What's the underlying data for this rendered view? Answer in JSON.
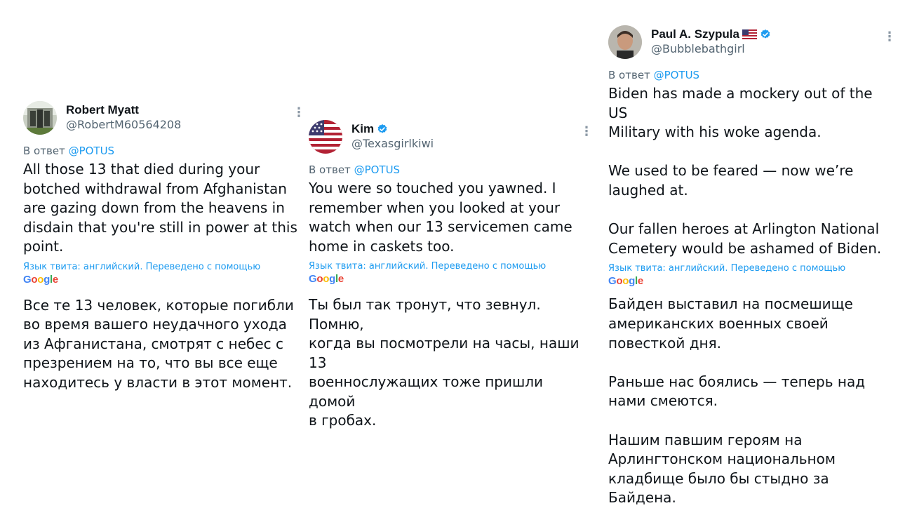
{
  "tweets": [
    {
      "display_name": "Robert Myatt",
      "handle": "@RobertM60564208",
      "verified": false,
      "more_icon": "more-vertical-icon",
      "reply_prefix": "В ответ",
      "reply_to": "@POTUS",
      "text": "All those 13 that died during your\nbotched withdrawal from Afghanistan\nare gazing down from the heavens in\ndisdain that you're still in power at this\npoint.",
      "translation_note": "Язык твита: английский. Переведено с помощью",
      "translation_provider": [
        "G",
        "o",
        "o",
        "g",
        "l",
        "e"
      ],
      "translated_text": "Все те 13 человек, которые погибли\nво время вашего неудачного ухода\nиз Афганистана, смотрят с небес с\nпрезрением на то, что вы все еще\nнаходитесь у власти в этот момент."
    },
    {
      "display_name": "Kim",
      "handle": "@Texasgirlkiwi",
      "verified": true,
      "more_icon": "more-vertical-icon",
      "reply_prefix": "В ответ",
      "reply_to": "@POTUS",
      "text": "You were so touched you yawned. I\nremember when you looked at your\nwatch when our 13 servicemen came\nhome in caskets too.",
      "translation_note": "Язык твита: английский. Переведено с помощью",
      "translation_provider": [
        "G",
        "o",
        "o",
        "g",
        "l",
        "e"
      ],
      "translated_text": "Ты был так тронут, что зевнул. Помню,\nкогда вы посмотрели на часы, наши 13\nвоеннослужащих тоже пришли домой\nв гробах."
    },
    {
      "display_name": "Paul A. Szypula",
      "handle": "@Bubblebathgirl",
      "verified": true,
      "flag": "🇺🇸",
      "more_icon": "more-vertical-icon",
      "reply_prefix": "В ответ",
      "reply_to": "@POTUS",
      "text": "Biden has made a mockery out of the US\nMilitary with his woke agenda.\n\nWe used to be feared — now we’re\nlaughed at.\n\nOur fallen heroes at Arlington National\nCemetery would be ashamed of Biden.",
      "translation_note": "Язык твита: английский. Переведено с помощью",
      "translation_provider": [
        "G",
        "o",
        "o",
        "g",
        "l",
        "e"
      ],
      "translated_text": "Байден выставил на посмешище\nамериканских военных своей\nповесткой дня.\n\nРаньше нас боялись — теперь над\nнами смеются.\n\nНашим павшим героям на\nАрлингтонском национальном\nкладбище было бы стыдно за Байдена."
    }
  ],
  "colors": {
    "accent": "#1d9bf0",
    "secondary_text": "#536471",
    "primary_text": "#0f1419"
  }
}
